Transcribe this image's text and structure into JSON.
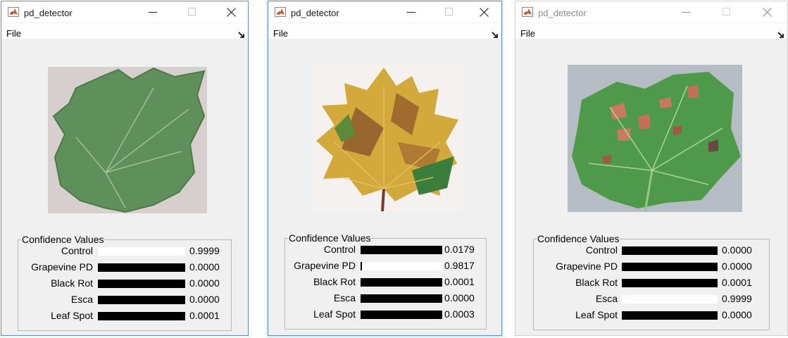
{
  "windows": [
    {
      "title": "pd_detector",
      "menu_file": "File",
      "group_title": "Confidence Values",
      "leaf_image": "healthy green grapevine leaf",
      "results": [
        {
          "label": "Control",
          "value": "0.9999",
          "bar_level": 0.0
        },
        {
          "label": "Grapevine PD",
          "value": "0.0000",
          "bar_level": 1.0
        },
        {
          "label": "Black Rot",
          "value": "0.0000",
          "bar_level": 1.0
        },
        {
          "label": "Esca",
          "value": "0.0000",
          "bar_level": 1.0
        },
        {
          "label": "Leaf Spot",
          "value": "0.0001",
          "bar_level": 1.0
        }
      ]
    },
    {
      "title": "pd_detector",
      "menu_file": "File",
      "group_title": "Confidence Values",
      "leaf_image": "yellow and brown grapevine leaf",
      "results": [
        {
          "label": "Control",
          "value": "0.0179",
          "bar_level": 1.0
        },
        {
          "label": "Grapevine PD",
          "value": "0.9817",
          "bar_level": 0.02
        },
        {
          "label": "Black Rot",
          "value": "0.0001",
          "bar_level": 1.0
        },
        {
          "label": "Esca",
          "value": "0.0000",
          "bar_level": 1.0
        },
        {
          "label": "Leaf Spot",
          "value": "0.0003",
          "bar_level": 1.0
        }
      ]
    },
    {
      "title": "pd_detector",
      "menu_file": "File",
      "group_title": "Confidence Values",
      "leaf_image": "green grapevine leaf with reddish-brown spots",
      "results": [
        {
          "label": "Control",
          "value": "0.0000",
          "bar_level": 1.0
        },
        {
          "label": "Grapevine PD",
          "value": "0.0000",
          "bar_level": 1.0
        },
        {
          "label": "Black Rot",
          "value": "0.0001",
          "bar_level": 1.0
        },
        {
          "label": "Esca",
          "value": "0.9999",
          "bar_level": 0.0
        },
        {
          "label": "Leaf Spot",
          "value": "0.0000",
          "bar_level": 1.0
        }
      ]
    }
  ],
  "icons": {
    "app": "matlab-icon",
    "minimize": "minimize-icon",
    "maximize": "maximize-icon",
    "close": "close-icon",
    "dock": "dock-arrow-icon"
  },
  "colors": {
    "window_bg": "#f0f0f0",
    "active_border": "#5c8fc7",
    "bar_fill": "#000000",
    "bar_empty": "#ffffff"
  }
}
